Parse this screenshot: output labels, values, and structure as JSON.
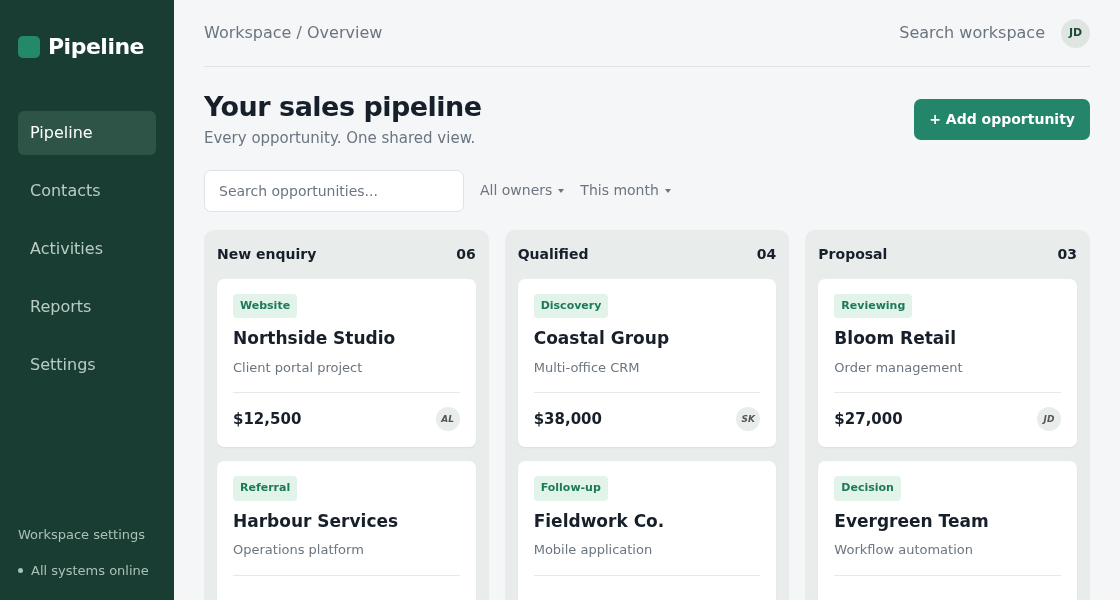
{
  "sidebar": {
    "logo": "Pipeline",
    "items": [
      {
        "label": "Pipeline",
        "selected": true
      },
      {
        "label": "Contacts",
        "selected": false
      },
      {
        "label": "Activities",
        "selected": false
      },
      {
        "label": "Reports",
        "selected": false
      },
      {
        "label": "Settings",
        "selected": false
      }
    ],
    "footer_link": "Workspace settings",
    "status": "All systems online"
  },
  "header": {
    "breadcrumb": "Workspace / Overview",
    "search": "Search workspace",
    "avatar": "JD"
  },
  "page": {
    "title": "Your sales pipeline",
    "subtitle": "Every opportunity. One shared view.",
    "add_button": "+ Add opportunity"
  },
  "filters": {
    "search": {
      "placeholder": "Search opportunities..."
    },
    "dropdowns": [
      "All owners",
      "This month"
    ]
  },
  "columns": [
    {
      "name": "New enquiry",
      "count": "06",
      "cards": [
        {
          "tag": "Website",
          "title": "Northside Studio",
          "subtitle": "Client portal project",
          "amount": "$12,500",
          "owner": "AL"
        },
        {
          "tag": "Referral",
          "title": "Harbour Services",
          "subtitle": "Operations platform"
        }
      ]
    },
    {
      "name": "Qualified",
      "count": "04",
      "cards": [
        {
          "tag": "Discovery",
          "title": "Coastal Group",
          "subtitle": "Multi-office CRM",
          "amount": "$38,000",
          "owner": "SK"
        },
        {
          "tag": "Follow-up",
          "title": "Fieldwork Co.",
          "subtitle": "Mobile application"
        }
      ]
    },
    {
      "name": "Proposal",
      "count": "03",
      "cards": [
        {
          "tag": "Reviewing",
          "title": "Bloom Retail",
          "subtitle": "Order management",
          "amount": "$27,000",
          "owner": "JD"
        },
        {
          "tag": "Decision",
          "title": "Evergreen Team",
          "subtitle": "Workflow automation"
        }
      ]
    }
  ]
}
